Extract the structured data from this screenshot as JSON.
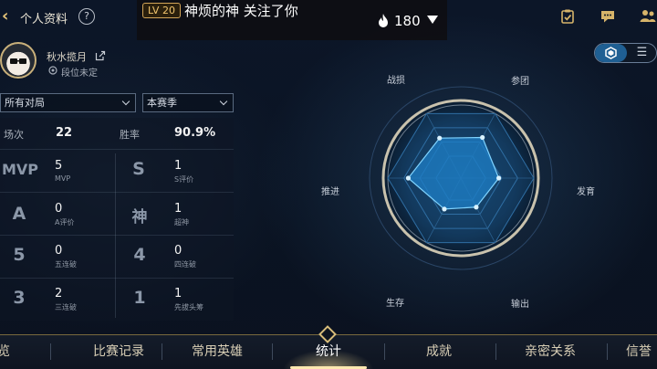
{
  "header": {
    "title": "个人资料",
    "help_glyph": "?"
  },
  "notification": {
    "level": "LV 20",
    "text": "神烦的神 关注了你",
    "heat_count": "180"
  },
  "profile": {
    "name": "秋水揽月",
    "location": "段位未定"
  },
  "filters": {
    "mode": "所有对局",
    "season": "本赛季"
  },
  "stats": {
    "matches_label": "场次",
    "matches_value": "22",
    "winrate_label": "胜率",
    "winrate_value": "90.9%",
    "rows": [
      {
        "left_badge": "MVP",
        "left_value": "5",
        "left_label": "MVP",
        "right_badge": "S",
        "right_value": "1",
        "right_label": "S评价"
      },
      {
        "left_badge": "A",
        "left_value": "0",
        "left_label": "A评价",
        "right_badge": "神",
        "right_value": "1",
        "right_label": "超神"
      },
      {
        "left_badge": "5",
        "left_value": "0",
        "left_label": "五连破",
        "right_badge": "4",
        "right_value": "0",
        "right_label": "四连破"
      },
      {
        "left_badge": "3",
        "left_value": "2",
        "left_label": "三连破",
        "right_badge": "1",
        "right_value": "1",
        "right_label": "先拔头筹"
      }
    ]
  },
  "radar": {
    "labels": [
      "战损",
      "参团",
      "发育",
      "输出",
      "生存",
      "推进"
    ],
    "values": [
      0.62,
      0.63,
      0.52,
      0.45,
      0.48,
      0.72
    ],
    "colors": {
      "fill": "#1e7fc7",
      "stroke": "#7fd3ff",
      "ring": "#c9c2ad"
    }
  },
  "bottom_nav": {
    "tabs": [
      "览",
      "比赛记录",
      "常用英雄",
      "统计",
      "成就",
      "亲密关系",
      "信誉"
    ],
    "active_index": 3
  },
  "view_toggle": {
    "list_glyph": "☰"
  },
  "colors": {
    "accent_gold": "#d6b46a",
    "active_blue": "#1f5f93"
  }
}
